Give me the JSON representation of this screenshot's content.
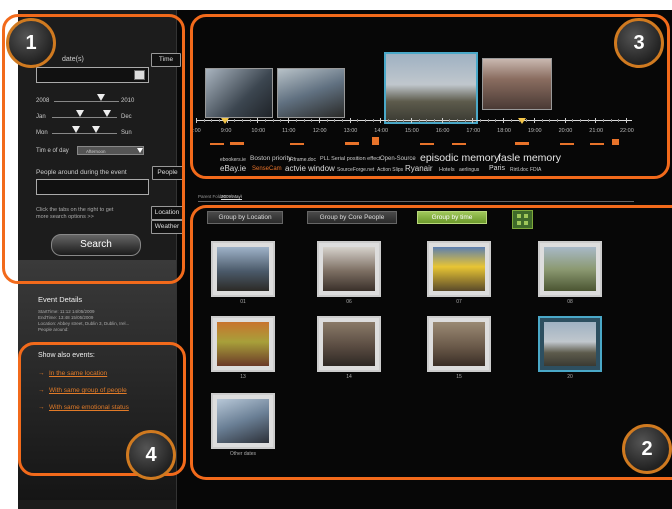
{
  "search": {
    "date_label": "date(s)",
    "time_button": "Time",
    "year_from": "2008",
    "year_to": "2010",
    "month_from": "Jan",
    "month_to": "Dec",
    "day_from": "Mon",
    "day_to": "Sun",
    "time_of_day_label": "Tim e of day",
    "time_of_day_value": "Afternoon",
    "people_label": "People around during the event",
    "people_button": "People",
    "hint_line1": "Click the tabs on the right to get",
    "hint_line2": "more search options >>",
    "location_button": "Location",
    "weather_button": "Weather",
    "search_button": "Search"
  },
  "event_details": {
    "title": "Event Details",
    "line1": "StartTime: 11:12 14/05/2009",
    "line2": "EndTime: 13:48 15/05/2009",
    "line3": "Location: Abbey street, Dublin 3, Dublin, Irel...",
    "line4": "People around:"
  },
  "show_also": {
    "title": "Show also events:",
    "links": [
      "In the same location",
      "With same group of people",
      "With same emotional status"
    ]
  },
  "timeline": {
    "ticks": [
      "9:00",
      "9:00",
      "10:00",
      "11:00",
      "12:00",
      "13:00",
      "14:00",
      "15:00",
      "16:00",
      "17:00",
      "18:00",
      "19:00",
      "20:00",
      "21:00",
      "22:00"
    ]
  },
  "tags": {
    "row1": [
      "ebookers.ie",
      "Boston priority",
      "iRframe.doc",
      "PLL Serial position effect",
      "Open-Source",
      "episodic memory",
      "fasle memory"
    ],
    "row2": [
      "eBay.ie",
      "SenseCam",
      "actvie window",
      "SourceForge.net",
      "Action Slips",
      "Ryanair",
      "Hotels",
      "aerlingus",
      "Paris",
      "Rirtl.doc",
      "FDIA"
    ]
  },
  "main": {
    "folder_label": "Parent Folder:",
    "folder_value": "2009\\May\\",
    "group_location": "Group by Location",
    "group_people": "Group by Core People",
    "group_time": "Group by time",
    "items": [
      {
        "caption": "01"
      },
      {
        "caption": "06"
      },
      {
        "caption": "07"
      },
      {
        "caption": "08"
      },
      {
        "caption": "13"
      },
      {
        "caption": "14"
      },
      {
        "caption": "15"
      },
      {
        "caption": "20"
      },
      {
        "caption": "Other dates"
      }
    ]
  },
  "callouts": {
    "c1": "1",
    "c2": "2",
    "c3": "3",
    "c4": "4"
  },
  "colors": {
    "accent": "#f26a1b",
    "highlight": "#4aa8c8",
    "group_active": "#7ea83a",
    "sensecam": "#e8732a"
  }
}
